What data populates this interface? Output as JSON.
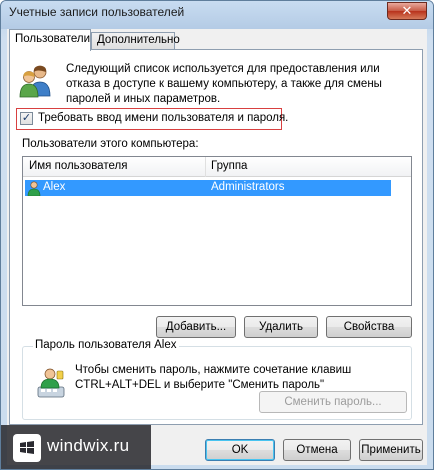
{
  "window": {
    "title": "Учетные записи пользователей",
    "close_label": "✕"
  },
  "tabs": [
    {
      "label": "Пользователи",
      "active": true
    },
    {
      "label": "Дополнительно",
      "active": false
    }
  ],
  "description": "Следующий список используется для предоставления или отказа в доступе к вашему компьютеру, а также для смены паролей и иных параметров.",
  "require_login": {
    "label": "Требовать ввод имени пользователя и пароля.",
    "checked": true,
    "mark": "✓"
  },
  "users_section_label": "Пользователи этого компьютера:",
  "users_table": {
    "columns": [
      "Имя пользователя",
      "Группа"
    ],
    "rows": [
      {
        "name": "Alex",
        "group": "Administrators",
        "selected": true
      }
    ]
  },
  "buttons": {
    "add": "Добавить...",
    "remove": "Удалить",
    "properties": "Свойства"
  },
  "password_group": {
    "title": "Пароль пользователя Alex",
    "text": "Чтобы сменить пароль, нажмите сочетание клавиш CTRL+ALT+DEL и выберите \"Сменить пароль\"",
    "change_button": "Сменить пароль..."
  },
  "dialog_buttons": {
    "ok": "OK",
    "cancel": "Отмена",
    "apply": "Применить"
  },
  "watermark": {
    "text": "windwix.ru"
  },
  "colors": {
    "selection": "#3399ff",
    "highlight_border": "#d84040"
  }
}
